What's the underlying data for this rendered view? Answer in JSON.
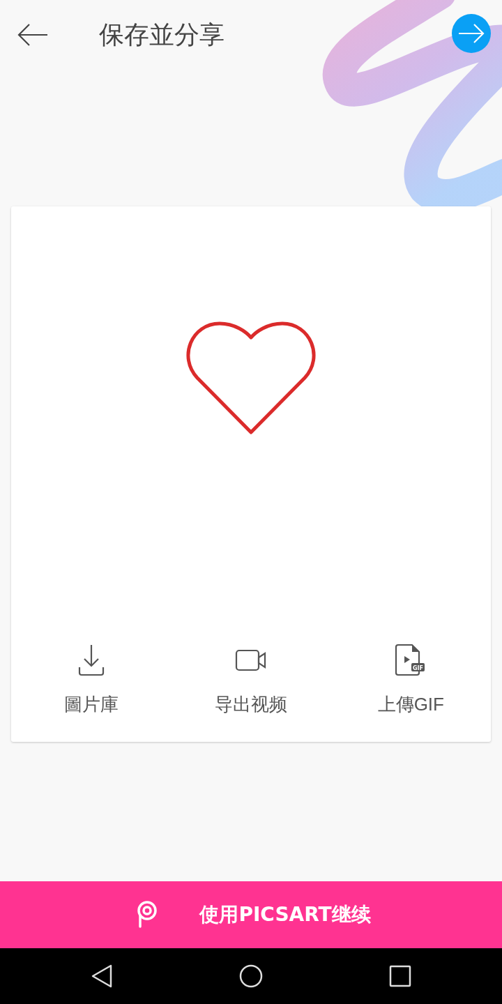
{
  "header": {
    "title": "保存並分享"
  },
  "actions": [
    {
      "kind": "download",
      "label": "圖片庫"
    },
    {
      "kind": "video",
      "label": "导出视频"
    },
    {
      "kind": "gif",
      "label": "上傳GIF",
      "badge": "GIF"
    }
  ],
  "continue_button": {
    "label": "使用PICSART继续"
  }
}
